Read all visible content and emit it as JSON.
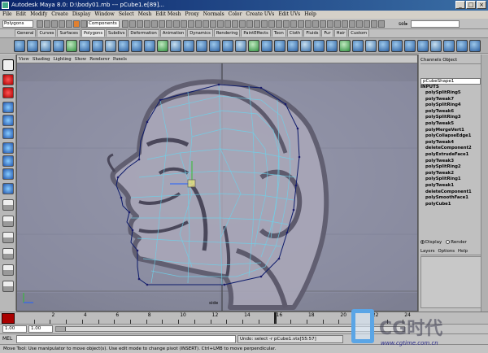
{
  "window": {
    "title": "Autodesk Maya 8.0: D:\\body01.mb  ---  pCube1.e[89]...",
    "buttons": [
      "_",
      "□",
      "×"
    ]
  },
  "menubar": [
    "File",
    "Edit",
    "Modify",
    "Create",
    "Display",
    "Window",
    "Select",
    "Mesh",
    "Edit Mesh",
    "Proxy",
    "Normals",
    "Color",
    "Create UVs",
    "Edit UVs",
    "Help"
  ],
  "status_line": {
    "mode": "Polygons",
    "component_field": "Components",
    "select_label": "sel▸"
  },
  "shelf_tabs": {
    "items": [
      "General",
      "Curves",
      "Surfaces",
      "Polygons",
      "Subdivs",
      "Deformation",
      "Animation",
      "Dynamics",
      "Rendering",
      "PaintEffects",
      "Toon",
      "Cloth",
      "Fluids",
      "Fur",
      "Hair",
      "Custom"
    ],
    "active": "Polygons"
  },
  "panel_menu": [
    "View",
    "Shading",
    "Lighting",
    "Show",
    "Renderer",
    "Panels"
  ],
  "viewport": {
    "camera_label": "side"
  },
  "channel_box": {
    "header": "Channels  Object",
    "object": "pCubeShape1",
    "inputs_label": "INPUTS",
    "inputs": [
      "polySplitRing5",
      "polyTweak7",
      "polySplitRing4",
      "polyTweak6",
      "polySplitRing3",
      "polyTweak5",
      "polyMergeVert1",
      "polyCollapseEdge1",
      "polyTweak4",
      "deleteComponent2",
      "polyExtrudeFace1",
      "polyTweak3",
      "polySplitRing2",
      "polyTweak2",
      "polySplitRing1",
      "polyTweak1",
      "deleteComponent1",
      "polySmoothFace1",
      "polyCube1"
    ]
  },
  "layer_editor": {
    "display_label": "Display",
    "render_label": "Render",
    "menu": [
      "Layers",
      "Options",
      "Help"
    ]
  },
  "timeline": {
    "ticks": [
      "2",
      "4",
      "6",
      "8",
      "10",
      "12",
      "14",
      "16",
      "18",
      "20",
      "22",
      "24"
    ],
    "current_frame": 16
  },
  "range_slider": {
    "start": "1.00",
    "inner_start": "1.00"
  },
  "command_line": {
    "mel_label": "MEL",
    "result": "Undo: select -r pCube1.vtx[55:57]"
  },
  "help_line": "Move Tool: Use manipulator to move object(s). Use edit mode to change pivot (INSERT). Ctrl+LMB to move perpendicular.",
  "watermark": {
    "text": "CG时代",
    "url": "www.cgtime.com.cn"
  }
}
